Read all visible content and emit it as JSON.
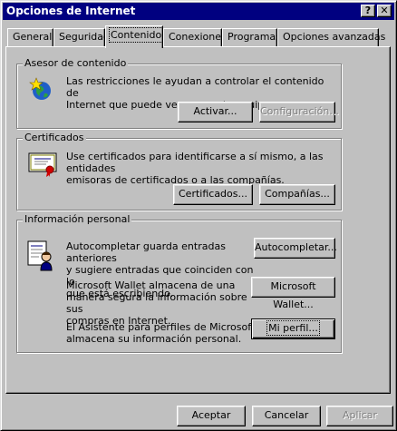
{
  "window": {
    "title": "Opciones de Internet",
    "help_glyph": "?",
    "close_glyph": "✕"
  },
  "tabs": [
    {
      "label": "General",
      "active": false
    },
    {
      "label": "Seguridad",
      "active": false
    },
    {
      "label": "Contenido",
      "active": true
    },
    {
      "label": "Conexiones",
      "active": false
    },
    {
      "label": "Programas",
      "active": false
    },
    {
      "label": "Opciones avanzadas",
      "active": false
    }
  ],
  "content_advisor": {
    "label": "Asesor de contenido",
    "description": "Las restricciones le ayudan a controlar el contenido de\nInternet que puede verse en este equipo.",
    "activate_button": "Activar...",
    "settings_button": "Configuración..."
  },
  "certificates": {
    "label": "Certificados",
    "description": "Use certificados para identificarse a sí mismo, a las entidades\nemisoras de certificados o a las compañías.",
    "certificates_button": "Certificados...",
    "companies_button": "Compañías..."
  },
  "personal_info": {
    "label": "Información personal",
    "autocomplete_text": "Autocompletar guarda entradas anteriores\ny sugiere entradas que coinciden con lo\nque está escribiendo.",
    "autocomplete_button": "Autocompletar...",
    "wallet_text": "Microsoft Wallet almacena de una\nmanera segura la información sobre sus\ncompras en Internet.",
    "wallet_button": "Microsoft Wallet...",
    "profile_text": "El Asistente para perfiles de Microsoft\nalmacena su información personal.",
    "profile_button": "Mi perfil..."
  },
  "footer": {
    "accept_button": "Aceptar",
    "cancel_button": "Cancelar",
    "apply_button": "Aplicar"
  },
  "colors": {
    "titlebar": "#000080",
    "face": "#c0c0c0"
  }
}
